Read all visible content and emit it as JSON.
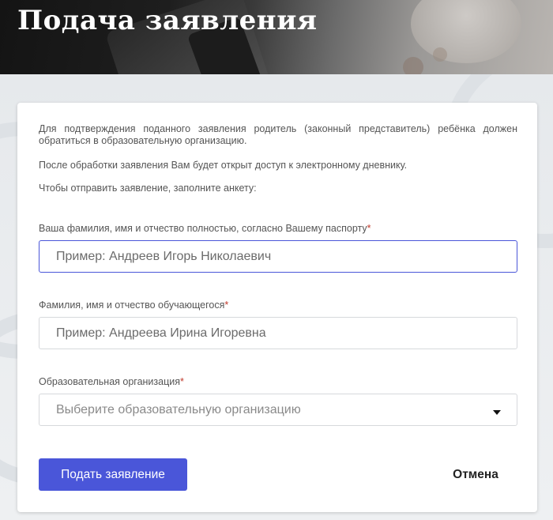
{
  "header": {
    "title": "Подача заявления"
  },
  "intro": {
    "paragraph1": "Для подтверждения поданного заявления родитель (законный представитель) ребёнка должен обратиться в образовательную организацию.",
    "paragraph2": "После обработки заявления Вам будет открыт доступ к электронному дневнику.",
    "paragraph3": "Чтобы отправить заявление, заполните анкету:"
  },
  "form": {
    "parent_name": {
      "label": "Ваша фамилия, имя и отчество полностью, согласно Вашему паспорту",
      "required_mark": "*",
      "value": "",
      "placeholder": "Пример: Андреев Игорь Николаевич"
    },
    "student_name": {
      "label": "Фамилия, имя и отчество обучающегося",
      "required_mark": "*",
      "value": "",
      "placeholder": "Пример: Андреева Ирина Игоревна"
    },
    "organization": {
      "label": "Образовательная организация",
      "required_mark": "*",
      "selected_text": "Выберите образовательную организацию",
      "icon": "chevron-down-icon"
    }
  },
  "actions": {
    "submit_label": "Подать заявление",
    "cancel_label": "Отмена"
  },
  "colors": {
    "accent": "#4a56d9",
    "required": "#c0392b",
    "card_background": "#ffffff",
    "page_background": "#e9ecef"
  }
}
